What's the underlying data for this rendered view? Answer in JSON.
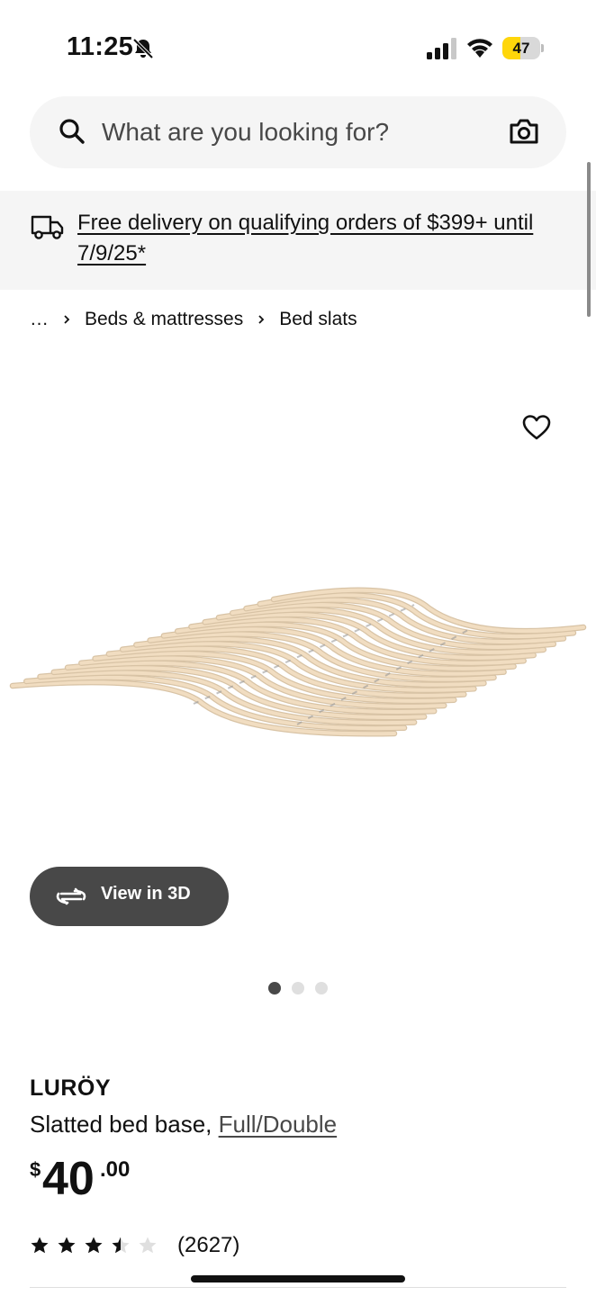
{
  "status_bar": {
    "time": "11:25",
    "battery_level": 47,
    "battery_text": "47"
  },
  "search": {
    "placeholder": "What are you looking for?"
  },
  "banner": {
    "text": "Free delivery on qualifying orders of $399+ until 7/9/25*"
  },
  "breadcrumb": {
    "items": [
      "…",
      "Beds & mattresses",
      "Bed slats"
    ]
  },
  "gallery": {
    "view_3d_label": "View in 3D",
    "image_count": 3,
    "active_image": 1
  },
  "product": {
    "brand": "LURÖY",
    "description": "Slatted bed base, ",
    "size_link": "Full/Double",
    "price_currency": "$",
    "price_integer": "40",
    "price_decimal": ".00",
    "rating": 3.5,
    "rating_max": 5,
    "review_count": "(2627)"
  },
  "colors": {
    "surface_gray": "#f5f5f5",
    "button_dark": "#484848",
    "battery_yellow": "#ffd60a",
    "slat_wood": "#f1ddc1"
  }
}
